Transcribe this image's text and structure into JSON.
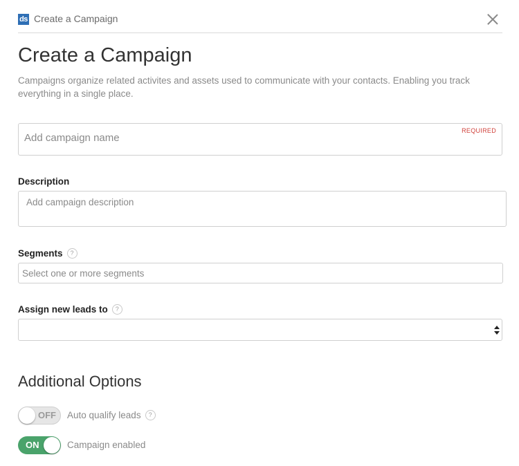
{
  "header": {
    "logo_text": "ds",
    "title": "Create a Campaign",
    "close_icon": "close-icon"
  },
  "page": {
    "title": "Create a Campaign",
    "intro": "Campaigns organize related activites and assets used to communicate with your contacts. Enabling you track everything in a single place."
  },
  "form": {
    "name": {
      "placeholder": "Add campaign name",
      "value": "",
      "required_label": "REQUIRED"
    },
    "description": {
      "label": "Description",
      "placeholder": "Add campaign description",
      "value": ""
    },
    "segments": {
      "label": "Segments",
      "help_icon": "question-icon",
      "placeholder": "Select one or more segments",
      "value": ""
    },
    "assign_leads": {
      "label": "Assign new leads to",
      "help_icon": "question-icon",
      "selected_value": ""
    }
  },
  "additional_options": {
    "title": "Additional Options",
    "auto_qualify": {
      "state": "OFF",
      "label": "Auto qualify leads",
      "help_icon": "question-icon"
    },
    "campaign_enabled": {
      "state": "ON",
      "label": "Campaign enabled"
    }
  },
  "colors": {
    "accent_green": "#4aa36b",
    "logo_blue": "#2f6fb5",
    "required_red": "#d0413b"
  }
}
